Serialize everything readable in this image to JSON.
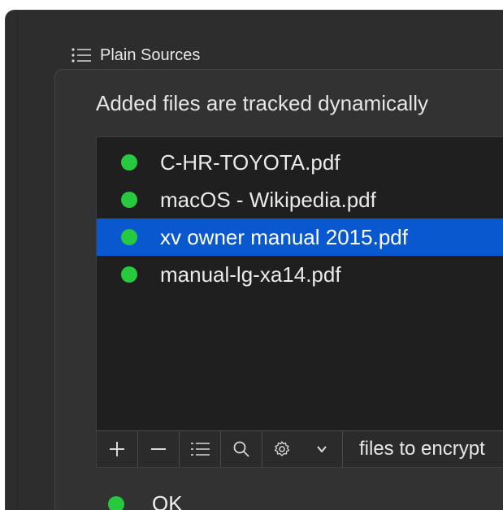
{
  "section": {
    "title": "Plain Sources",
    "icon": "list-icon"
  },
  "description": "Added files are tracked dynamically",
  "files": [
    {
      "name": "C-HR-TOYOTA.pdf",
      "status_color": "#27c93f",
      "selected": false
    },
    {
      "name": "macOS - Wikipedia.pdf",
      "status_color": "#27c93f",
      "selected": false
    },
    {
      "name": "xv owner manual 2015.pdf",
      "status_color": "#27c93f",
      "selected": true
    },
    {
      "name": "manual-lg-xa14.pdf",
      "status_color": "#27c93f",
      "selected": false
    }
  ],
  "toolbar": {
    "add_icon": "plus-icon",
    "remove_icon": "minus-icon",
    "list_icon": "list-icon",
    "search_icon": "search-icon",
    "settings_icon": "gear-icon",
    "dropdown_icon": "chevron-down-icon",
    "label": "files to encrypt"
  },
  "status": {
    "text": "OK",
    "color": "#27c93f"
  },
  "colors": {
    "selection": "#0a58d0",
    "status_green": "#27c93f"
  }
}
